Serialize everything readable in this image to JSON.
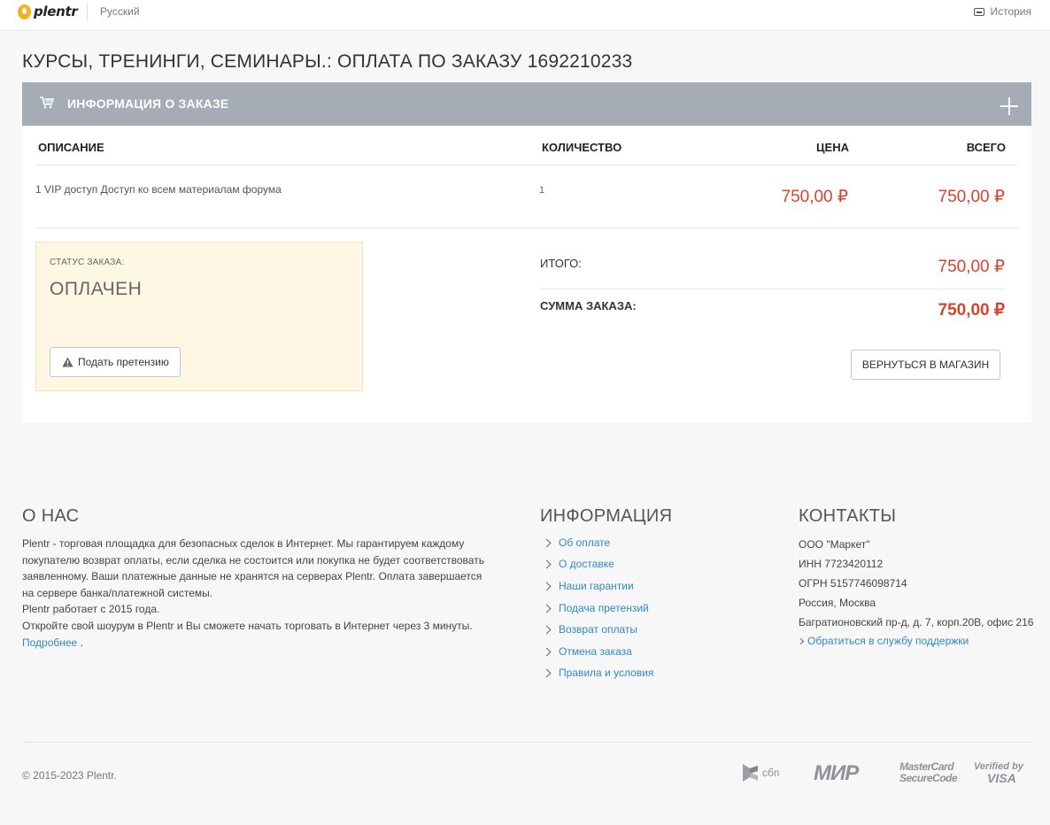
{
  "topbar": {
    "brand": "plentr",
    "language": "Русский",
    "history": "История"
  },
  "page": {
    "title": "КУРСЫ, ТРЕНИНГИ, СЕМИНАРЫ.: ОПЛАТА ПО ЗАКАЗУ 1692210233"
  },
  "order": {
    "header": "ИНФОРМАЦИЯ О ЗАКАЗЕ",
    "columns": {
      "description": "ОПИСАНИЕ",
      "quantity": "КОЛИЧЕСТВО",
      "price": "ЦЕНА",
      "total": "ВСЕГО"
    },
    "items": [
      {
        "description": "1 VIP доступ Доступ ко всем материалам форума",
        "quantity": "1",
        "price": "750,00 ₽",
        "total": "750,00 ₽"
      }
    ],
    "status_label": "СТАТУС ЗАКАЗА:",
    "status_value": "ОПЛАЧЕН",
    "claim_button": "Подать претензию",
    "subtotal_label": "ИТОГО:",
    "subtotal_value": "750,00 ₽",
    "sum_label": "СУММА ЗАКАЗА:",
    "sum_value": "750,00 ₽",
    "back_button": "ВЕРНУТЬСЯ В МАГАЗИН"
  },
  "footer": {
    "about": {
      "title": "О НАС",
      "p1": "Plentr - торговая площадка для безопасных сделок в Интернет. Мы гарантируем каждому покупателю возврат оплаты, если сделка не состоится или покупка не будет соответствовать заявленному. Ваши платежные данные не хранятся на серверах Plentr. Оплата завершается на сервере банка/платежной системы.",
      "p2": "Plentr работает с 2015 года.",
      "p3": "Откройте свой шоурум в Plentr и Вы сможете начать торговать в Интернет через 3 минуты.",
      "more_link": "Подробнее",
      "more_suffix": " ."
    },
    "info": {
      "title": "ИНФОРМАЦИЯ",
      "links": [
        "Об оплате",
        "О доставке",
        "Наши гарантии",
        "Подача претензий",
        "Возврат оплаты",
        "Отмена заказа",
        "Правила и условия"
      ]
    },
    "contacts": {
      "title": "КОНТАКТЫ",
      "company": "ООО \"Маркет\"",
      "inn": "ИНН 7723420112",
      "ogrn": "ОГРН 5157746098714",
      "city": "Россия, Москва",
      "address": "Багратионовский пр-д, д. 7, корп.20В, офис 216",
      "support_link": "Обратиться в службу поддержки"
    },
    "copyright": "© 2015-2023 Plentr.",
    "payment_logos": {
      "sbp": "сбп",
      "mir": "МИР",
      "mc_line1": "MasterCard",
      "mc_line2": "SecureCode",
      "visa_line1": "Verified by",
      "visa_line2": "VISA"
    }
  },
  "colors": {
    "accent_price": "#d5452d",
    "header_bar": "#a5acb5",
    "status_bg": "#fdf7e3",
    "link": "#2f8ac3"
  }
}
